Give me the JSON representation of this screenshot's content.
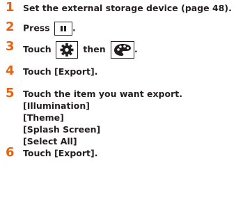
{
  "steps": [
    {
      "num": "1",
      "text": "Set the external storage device (page 48)."
    },
    {
      "num": "2",
      "text": "Press",
      "after": ".",
      "icon": "pause-icon"
    },
    {
      "num": "3",
      "text": "Touch",
      "middle": "then",
      "after": ".",
      "icons": [
        "gear-icon",
        "palette-icon"
      ]
    },
    {
      "num": "4",
      "text": "Touch [Export]."
    },
    {
      "num": "5",
      "text": "Touch the item you want export.",
      "options": [
        "[Illumination]",
        "[Theme]",
        "[Splash Screen]",
        "[Select All]"
      ]
    },
    {
      "num": "6",
      "text": "Touch [Export]."
    }
  ],
  "colors": {
    "step_number": "#e8620f",
    "text": "#231f20"
  }
}
